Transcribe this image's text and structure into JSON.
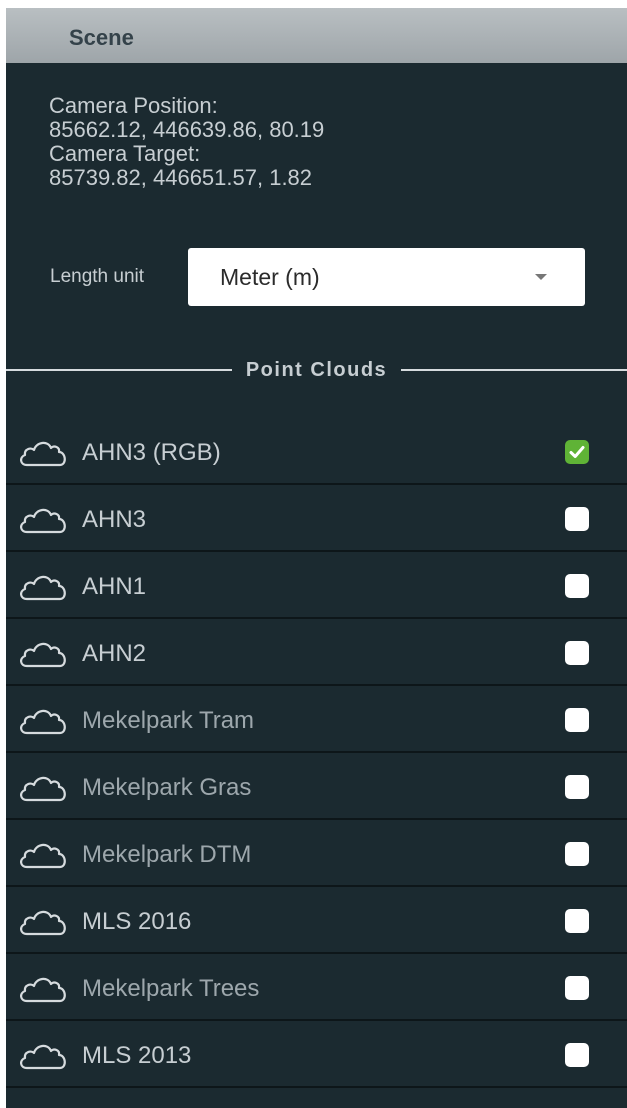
{
  "scene": {
    "title": "Scene"
  },
  "camera": {
    "position_label": "Camera Position:",
    "position_value": "85662.12, 446639.86, 80.19",
    "target_label": "Camera Target:",
    "target_value": "85739.82, 446651.57, 1.82"
  },
  "length_unit": {
    "label": "Length unit",
    "selected": "Meter (m)"
  },
  "point_clouds": {
    "section_label": "Point Clouds",
    "items": [
      {
        "label": "AHN3 (RGB)",
        "checked": true,
        "dim": false
      },
      {
        "label": "AHN3",
        "checked": false,
        "dim": false
      },
      {
        "label": "AHN1",
        "checked": false,
        "dim": false
      },
      {
        "label": "AHN2",
        "checked": false,
        "dim": false
      },
      {
        "label": "Mekelpark Tram",
        "checked": false,
        "dim": true
      },
      {
        "label": "Mekelpark Gras",
        "checked": false,
        "dim": true
      },
      {
        "label": "Mekelpark DTM",
        "checked": false,
        "dim": true
      },
      {
        "label": "MLS 2016",
        "checked": false,
        "dim": false
      },
      {
        "label": "Mekelpark Trees",
        "checked": false,
        "dim": true
      },
      {
        "label": "MLS 2013",
        "checked": false,
        "dim": false
      }
    ]
  },
  "colors": {
    "panel_bg": "#1b2a30",
    "check_on": "#5fb336"
  },
  "icons": {
    "item_icon": "cloud-icon",
    "dropdown_icon": "caret-down-icon",
    "check_icon": "checkmark-icon"
  }
}
